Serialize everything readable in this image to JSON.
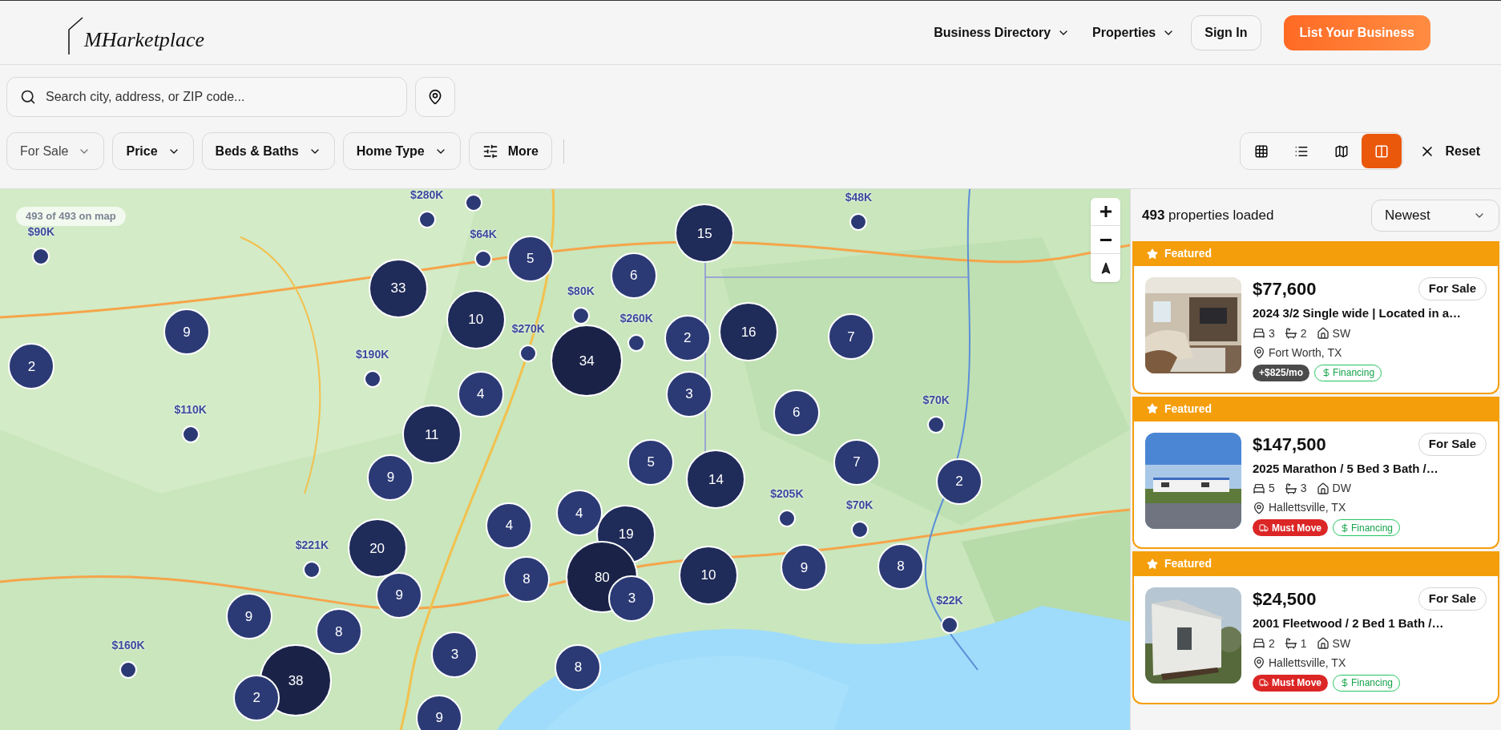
{
  "header": {
    "logo": "MHarketplace",
    "nav": [
      {
        "label": "Business Directory",
        "kind": "menu"
      },
      {
        "label": "Properties",
        "kind": "menu"
      },
      {
        "label": "Sign In",
        "kind": "outline"
      },
      {
        "label": "List Your Business",
        "kind": "primary"
      }
    ]
  },
  "search": {
    "placeholder": "Search city, address, or ZIP code..."
  },
  "filters": [
    {
      "label": "For Sale",
      "kind": "value"
    },
    {
      "label": "Price",
      "kind": "dropdown"
    },
    {
      "label": "Beds & Baths",
      "kind": "dropdown"
    },
    {
      "label": "Home Type",
      "kind": "dropdown"
    },
    {
      "label": "More",
      "kind": "more"
    }
  ],
  "views": [
    {
      "kind": "grid",
      "selected": false
    },
    {
      "kind": "list",
      "selected": false
    },
    {
      "kind": "map",
      "selected": false
    },
    {
      "kind": "split",
      "selected": true
    }
  ],
  "reset": "Reset",
  "map": {
    "badge": "493 of 493 on map",
    "clusters": [
      {
        "count": "33",
        "kind": "large"
      },
      {
        "count": "10",
        "kind": "large"
      },
      {
        "count": "5",
        "kind": "medium"
      },
      {
        "count": "6",
        "kind": "medium"
      },
      {
        "count": "15",
        "kind": "large"
      },
      {
        "count": "9",
        "kind": "medium"
      },
      {
        "count": "2",
        "kind": "medium"
      },
      {
        "count": "2",
        "kind": "medium"
      },
      {
        "count": "16",
        "kind": "large"
      },
      {
        "count": "7",
        "kind": "medium"
      },
      {
        "count": "34",
        "kind": "xl"
      },
      {
        "count": "4",
        "kind": "medium"
      },
      {
        "count": "3",
        "kind": "medium"
      },
      {
        "count": "6",
        "kind": "medium"
      },
      {
        "count": "11",
        "kind": "large"
      },
      {
        "count": "9",
        "kind": "medium"
      },
      {
        "count": "5",
        "kind": "medium"
      },
      {
        "count": "14",
        "kind": "large"
      },
      {
        "count": "7",
        "kind": "medium"
      },
      {
        "count": "2",
        "kind": "medium"
      },
      {
        "count": "4",
        "kind": "medium"
      },
      {
        "count": "4",
        "kind": "medium"
      },
      {
        "count": "19",
        "kind": "large"
      },
      {
        "count": "20",
        "kind": "large"
      },
      {
        "count": "8",
        "kind": "medium"
      },
      {
        "count": "80",
        "kind": "xl"
      },
      {
        "count": "10",
        "kind": "large"
      },
      {
        "count": "9",
        "kind": "medium"
      },
      {
        "count": "8",
        "kind": "medium"
      },
      {
        "count": "9",
        "kind": "medium"
      },
      {
        "count": "3",
        "kind": "medium"
      },
      {
        "count": "9",
        "kind": "medium"
      },
      {
        "count": "8",
        "kind": "medium"
      },
      {
        "count": "3",
        "kind": "medium"
      },
      {
        "count": "8",
        "kind": "medium"
      },
      {
        "count": "38",
        "kind": "xl"
      },
      {
        "count": "2",
        "kind": "medium"
      },
      {
        "count": "9",
        "kind": "medium"
      }
    ],
    "price_pins": [
      {
        "kind": "priced",
        "label": "$280K"
      },
      {
        "kind": "priced",
        "label": "$48K"
      },
      {
        "kind": "dot"
      },
      {
        "kind": "priced",
        "label": "$90K"
      },
      {
        "kind": "priced",
        "label": "$64K"
      },
      {
        "kind": "priced",
        "label": "$80K"
      },
      {
        "kind": "priced",
        "label": "$260K"
      },
      {
        "kind": "priced",
        "label": "$270K"
      },
      {
        "kind": "priced",
        "label": "$190K"
      },
      {
        "kind": "priced",
        "label": "$70K"
      },
      {
        "kind": "priced",
        "label": "$110K"
      },
      {
        "kind": "priced",
        "label": "$205K"
      },
      {
        "kind": "priced",
        "label": "$70K"
      },
      {
        "kind": "priced",
        "label": "$221K"
      },
      {
        "kind": "priced",
        "label": "$22K"
      },
      {
        "kind": "priced",
        "label": "$160K"
      }
    ]
  },
  "results": {
    "count": "493",
    "text": "properties loaded",
    "sort": "Newest"
  },
  "listings": [
    {
      "featured": "Featured",
      "price": "$77,600",
      "status": "For Sale",
      "title": "2024 3/2 Single wide | Located in a…",
      "beds": "3",
      "baths": "2",
      "type": "SW",
      "location": "Fort Worth, TX",
      "tags": [
        {
          "kind": "payment",
          "label": "+$825/mo"
        },
        {
          "kind": "financing",
          "label": "Financing"
        }
      ]
    },
    {
      "featured": "Featured",
      "price": "$147,500",
      "status": "For Sale",
      "title": "2025 Marathon / 5 Bed 3 Bath /…",
      "beds": "5",
      "baths": "3",
      "type": "DW",
      "location": "Hallettsville, TX",
      "tags": [
        {
          "kind": "urgent",
          "label": "Must Move"
        },
        {
          "kind": "financing",
          "label": "Financing"
        }
      ]
    },
    {
      "featured": "Featured",
      "price": "$24,500",
      "status": "For Sale",
      "title": "2001 Fleetwood / 2 Bed 1 Bath /…",
      "beds": "2",
      "baths": "1",
      "type": "SW",
      "location": "Hallettsville, TX",
      "tags": [
        {
          "kind": "urgent",
          "label": "Must Move"
        },
        {
          "kind": "financing",
          "label": "Financing"
        }
      ]
    }
  ]
}
